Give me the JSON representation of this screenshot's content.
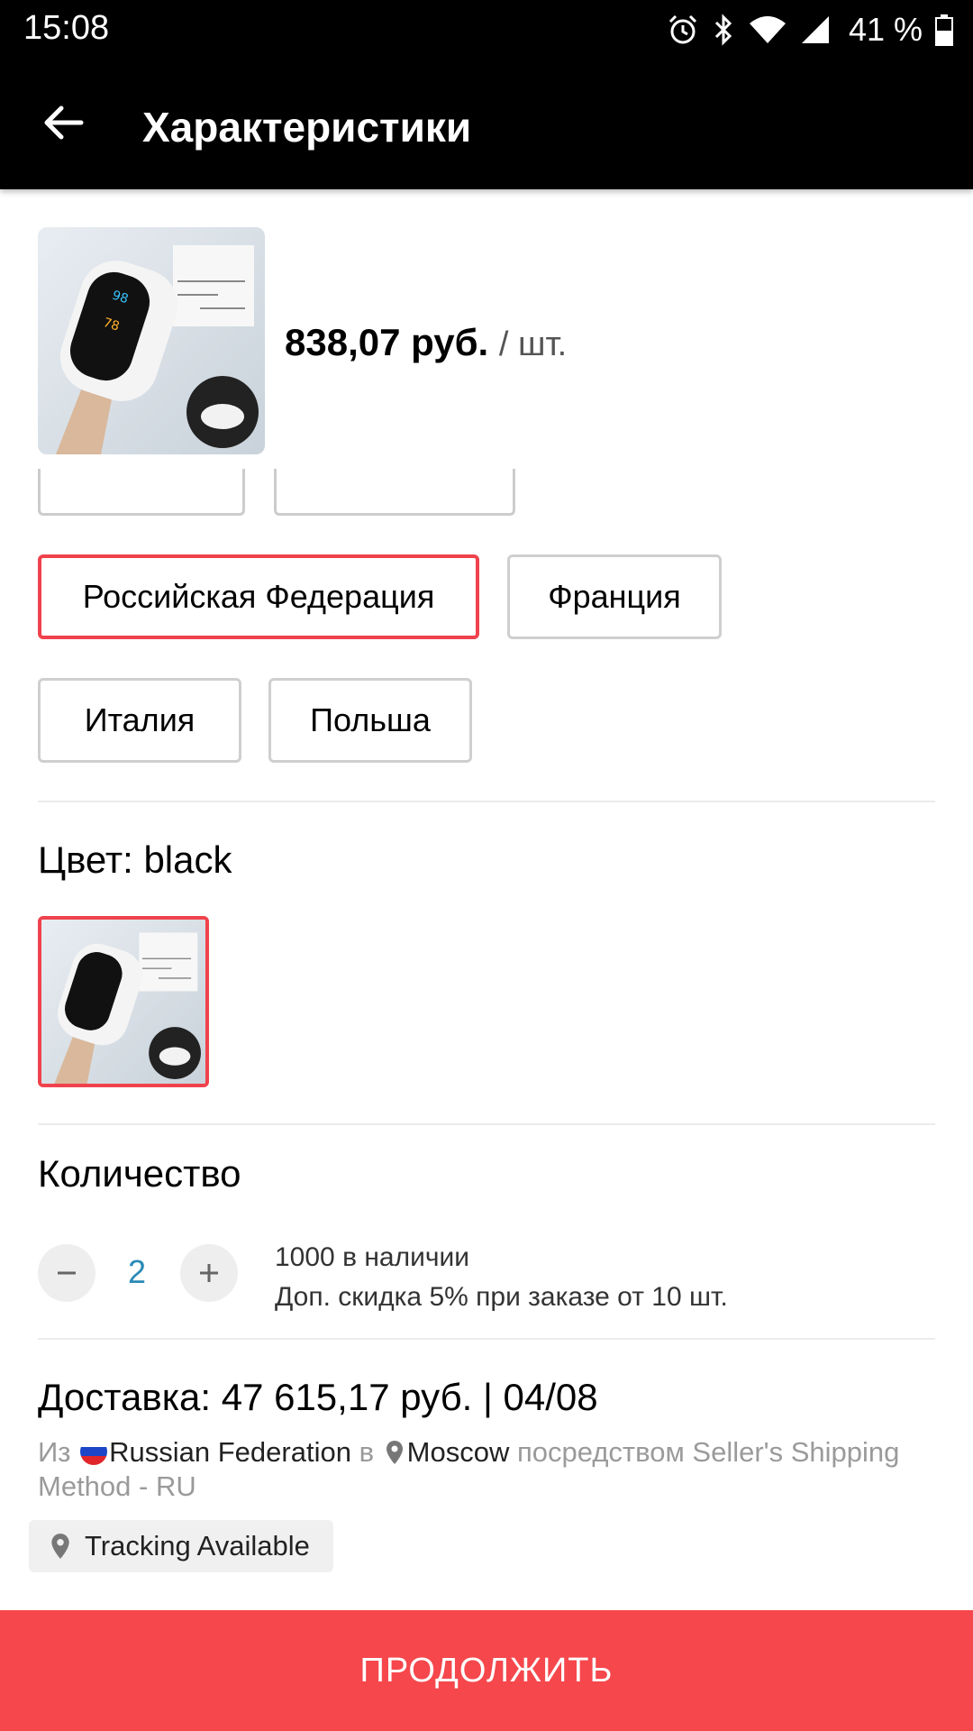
{
  "status_bar": {
    "time": "15:08",
    "battery_text": "41 %",
    "icons": [
      "alarm-icon",
      "bluetooth-icon",
      "wifi-icon",
      "signal-icon",
      "battery-icon"
    ]
  },
  "app_bar": {
    "title": "Характеристики",
    "back_icon": "arrow-back-icon"
  },
  "product": {
    "price": "838,07 руб.",
    "unit": "/ шт."
  },
  "ship_from": {
    "options": [
      {
        "label": "Российская Федерация",
        "selected": true
      },
      {
        "label": "Франция",
        "selected": false
      },
      {
        "label": "Италия",
        "selected": false
      },
      {
        "label": "Польша",
        "selected": false
      }
    ]
  },
  "color": {
    "title": "Цвет: black"
  },
  "quantity": {
    "title": "Количество",
    "value": "2",
    "stock": "1000 в наличии",
    "discount": "Доп. скидка 5% при заказе от 10 шт."
  },
  "delivery": {
    "title": "Доставка: 47 615,17 руб. | 04/08",
    "from_prefix": "Из",
    "from": "Russian Federation",
    "to_prefix": "в",
    "to": "Moscow",
    "method": "посредством Seller's Shipping Method - RU",
    "tracking": "Tracking Available"
  },
  "continue_button": "ПРОДОЛЖИТЬ",
  "colors": {
    "accent": "#f5474c",
    "selected_border": "#f0424c",
    "qty_text": "#2b8ab6"
  }
}
